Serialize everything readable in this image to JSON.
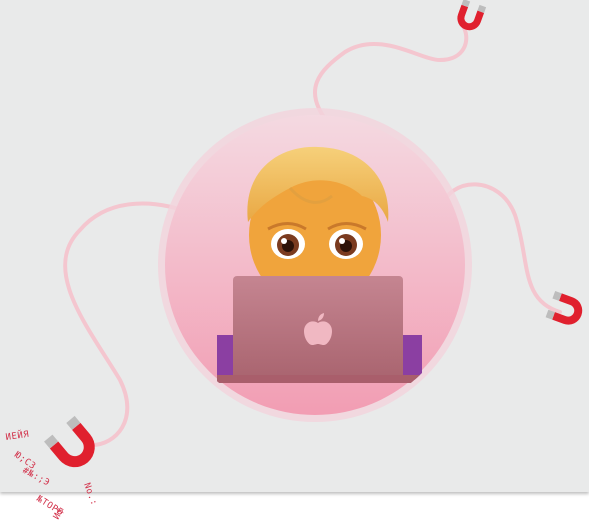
{
  "scene": {
    "background_color": "#e9eaea",
    "wire_color": "#f4c6cf",
    "magnet_color": "#e0202e",
    "magnet_tip_color": "#bdbdbd",
    "bubble_color": "#f2a9bd",
    "skin_color": "#f0a43c",
    "hair_color": "#f3c15a",
    "laptop_color": "#b9727e",
    "sleeve_color": "#8b3fa2",
    "icons": [
      "magnet-icon",
      "technologist-emoji",
      "laptop-icon",
      "apple-logo-icon"
    ]
  },
  "stamp": {
    "line1": "ИЕЙЯ",
    "line2": "Ю;СЗ",
    "line3": "No.:",
    "line4": "#№:;Э",
    "line5": "№ТОРБ",
    "line6": "И$"
  }
}
